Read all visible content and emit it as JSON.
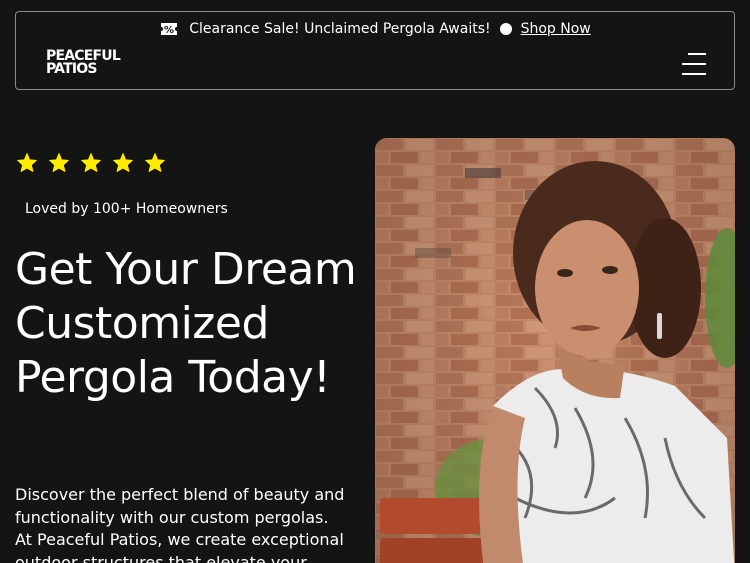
{
  "promo": {
    "text": "Clearance Sale! Unclaimed Pergola Awaits!",
    "link": "Shop Now"
  },
  "logo": {
    "line1": "PEACEFUL",
    "line2": "PATIOS"
  },
  "hero": {
    "rating_stars": 5,
    "loved_text": "Loved by 100+ Homeowners",
    "headline": "Get Your Dream Customized Pergola Today!",
    "description": "Discover the perfect blend of beauty and functionality with our custom pergolas. At Peaceful Patios, we create exceptional outdoor structures that elevate your"
  },
  "colors": {
    "background": "#141414",
    "star": "#ffeb00",
    "text": "#ffffff"
  }
}
